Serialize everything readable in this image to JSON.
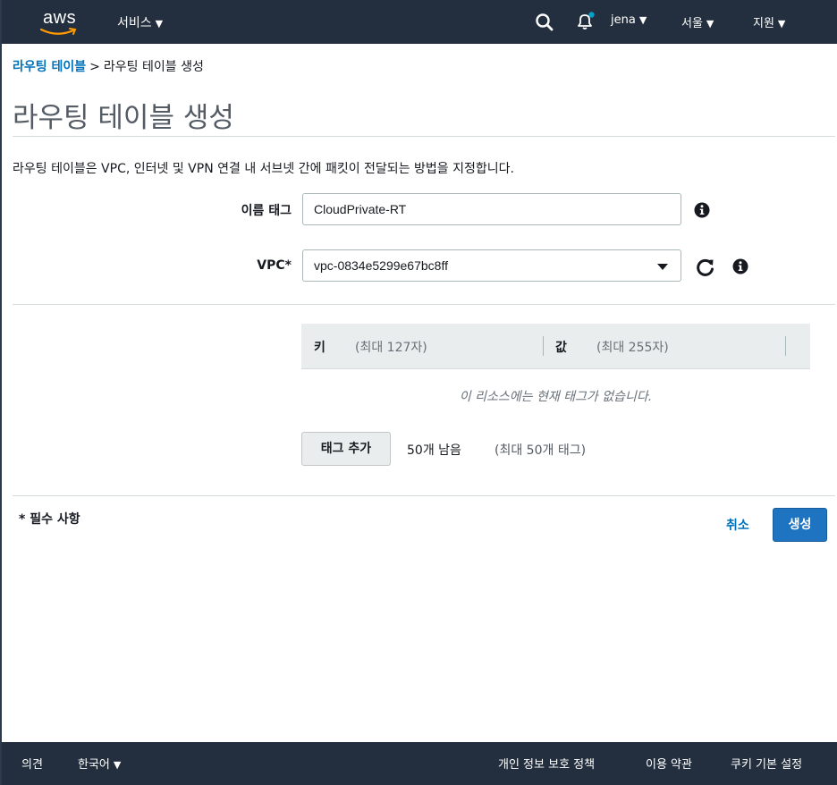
{
  "topnav": {
    "logo_text": "aws",
    "services_label": "서비스",
    "user_label": "jena",
    "region_label": "서울",
    "support_label": "지원",
    "notification_dot_color": "#00a1c9"
  },
  "breadcrumb": {
    "parent": "라우팅 테이블",
    "separator": ">",
    "current": "라우팅 테이블 생성"
  },
  "page": {
    "title": "라우팅 테이블 생성",
    "description": "라우팅 테이블은 VPC, 인터넷 및 VPN 연결 내 서브넷 간에 패킷이 전달되는 방법을 지정합니다."
  },
  "form": {
    "name_tag_label": "이름 태그",
    "name_tag_value": "CloudPrivate-RT",
    "vpc_label": "VPC*",
    "vpc_value": "vpc-0834e5299e67bc8ff"
  },
  "tags": {
    "key_header": "키",
    "key_hint": "(최대 127자)",
    "value_header": "값",
    "value_hint": "(최대 255자)",
    "empty_message": "이 리소스에는 현재 태그가 없습니다.",
    "add_button": "태그 추가",
    "remaining": "50개 남음",
    "remaining_hint": "(최대 50개 태그)"
  },
  "actions": {
    "required_note": "* 필수 사항",
    "cancel": "취소",
    "create": "생성"
  },
  "footer": {
    "feedback": "의견",
    "language": "한국어",
    "privacy": "개인 정보 보호 정책",
    "terms": "이용 약관",
    "cookies": "쿠키 기본 설정"
  },
  "icons": {
    "search": "search-icon",
    "bell": "bell-icon",
    "info": "info-icon",
    "refresh": "refresh-icon"
  }
}
